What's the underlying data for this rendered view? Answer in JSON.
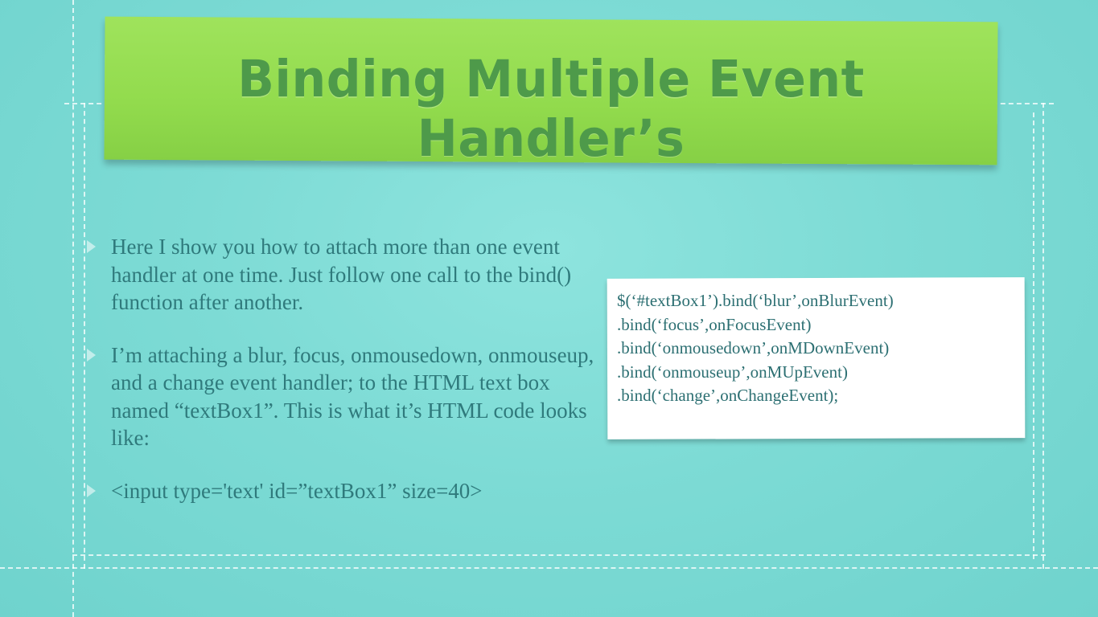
{
  "slide": {
    "title": "Binding Multiple Event Handler’s",
    "bullets": [
      "Here I show you how to attach more than one event handler at one time. Just follow one call to the bind() function after another.",
      "I’m attaching a blur, focus, onmousedown, onmouseup, and a change event handler; to the HTML text box named “textBox1”. This is what it’s HTML code looks like:",
      "<input type='text' id=”textBox1” size=40>"
    ],
    "code_lines": [
      "$(‘#textBox1’).bind(‘blur’,onBlurEvent)",
      ".bind(‘focus’,onFocusEvent)",
      ".bind(‘onmousedown’,onMDownEvent)",
      ".bind(‘onmouseup’,onMUpEvent)",
      ".bind(‘change’,onChangeEvent);"
    ]
  },
  "colors": {
    "background": "#7ddbd5",
    "banner": "#92db4d",
    "title_text": "#4e9a4a",
    "body_text": "#2f7a7c",
    "code_text": "#2c6f72",
    "card": "#ffffff"
  }
}
